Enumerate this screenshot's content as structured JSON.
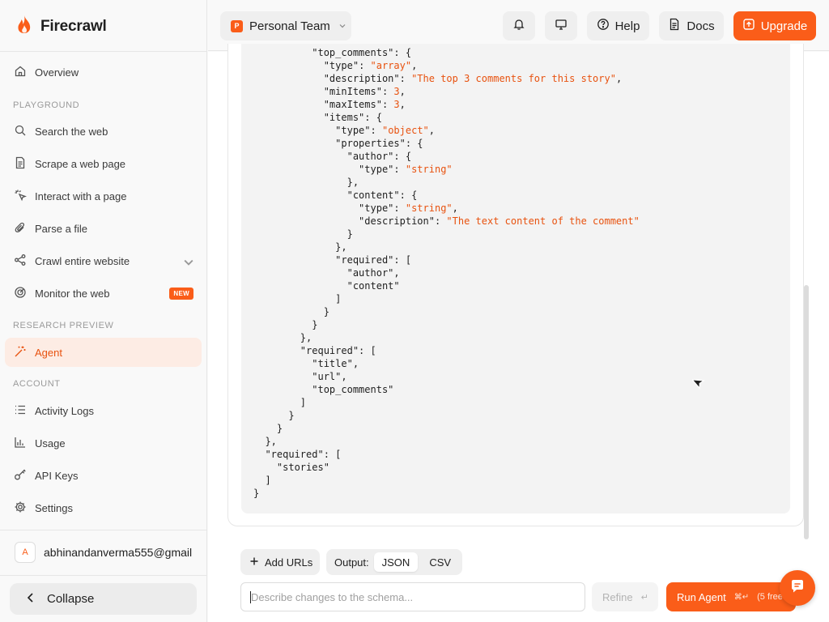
{
  "brand": {
    "name": "Firecrawl",
    "accent": "#fa5d19"
  },
  "sidebar": {
    "items_top": [
      {
        "label": "Overview",
        "icon": "home-icon"
      }
    ],
    "section_playground": "PLAYGROUND",
    "playground": [
      {
        "label": "Search the web",
        "icon": "search-icon"
      },
      {
        "label": "Scrape a web page",
        "icon": "document-icon"
      },
      {
        "label": "Interact with a page",
        "icon": "sparkle-click-icon"
      },
      {
        "label": "Parse a file",
        "icon": "paperclip-icon"
      },
      {
        "label": "Crawl entire website",
        "icon": "crawl-icon"
      },
      {
        "label": "Monitor the web",
        "icon": "monitor-radar-icon",
        "badge": "NEW"
      }
    ],
    "section_research": "RESEARCH PREVIEW",
    "research": [
      {
        "label": "Agent",
        "icon": "wand-icon",
        "active": true
      }
    ],
    "section_account": "ACCOUNT",
    "account": [
      {
        "label": "Activity Logs",
        "icon": "list-icon"
      },
      {
        "label": "Usage",
        "icon": "bar-chart-icon"
      },
      {
        "label": "API Keys",
        "icon": "key-icon"
      },
      {
        "label": "Settings",
        "icon": "gear-icon"
      }
    ],
    "user": {
      "avatar_letter": "A",
      "email": "abhinandanverma555@gmail"
    },
    "collapse_label": "Collapse"
  },
  "topbar": {
    "team_logo_letter": "P",
    "team_name": "Personal Team",
    "help_label": "Help",
    "docs_label": "Docs",
    "upgrade_label": "Upgrade"
  },
  "schema_code": {
    "lines": [
      [
        [
          "          ",
          ""
        ],
        [
          "\"top_comments\"",
          "k"
        ],
        [
          ": {",
          ""
        ]
      ],
      [
        [
          "            ",
          ""
        ],
        [
          "\"type\"",
          "k"
        ],
        [
          ": ",
          ""
        ],
        [
          "\"array\"",
          "s"
        ],
        [
          ",",
          ""
        ]
      ],
      [
        [
          "            ",
          ""
        ],
        [
          "\"description\"",
          "k"
        ],
        [
          ": ",
          ""
        ],
        [
          "\"The top 3 comments for this story\"",
          "s"
        ],
        [
          ",",
          ""
        ]
      ],
      [
        [
          "            ",
          ""
        ],
        [
          "\"minItems\"",
          "k"
        ],
        [
          ": ",
          ""
        ],
        [
          "3",
          "s"
        ],
        [
          ",",
          ""
        ]
      ],
      [
        [
          "            ",
          ""
        ],
        [
          "\"maxItems\"",
          "k"
        ],
        [
          ": ",
          ""
        ],
        [
          "3",
          "s"
        ],
        [
          ",",
          ""
        ]
      ],
      [
        [
          "            ",
          ""
        ],
        [
          "\"items\"",
          "k"
        ],
        [
          ": {",
          ""
        ]
      ],
      [
        [
          "              ",
          ""
        ],
        [
          "\"type\"",
          "k"
        ],
        [
          ": ",
          ""
        ],
        [
          "\"object\"",
          "s"
        ],
        [
          ",",
          ""
        ]
      ],
      [
        [
          "              ",
          ""
        ],
        [
          "\"properties\"",
          "k"
        ],
        [
          ": {",
          ""
        ]
      ],
      [
        [
          "                ",
          ""
        ],
        [
          "\"author\"",
          "k"
        ],
        [
          ": {",
          ""
        ]
      ],
      [
        [
          "                  ",
          ""
        ],
        [
          "\"type\"",
          "k"
        ],
        [
          ": ",
          ""
        ],
        [
          "\"string\"",
          "s"
        ]
      ],
      [
        [
          "                ",
          ""
        ],
        [
          "},",
          ""
        ]
      ],
      [
        [
          "                ",
          ""
        ],
        [
          "\"content\"",
          "k"
        ],
        [
          ": {",
          ""
        ]
      ],
      [
        [
          "                  ",
          ""
        ],
        [
          "\"type\"",
          "k"
        ],
        [
          ": ",
          ""
        ],
        [
          "\"string\"",
          "s"
        ],
        [
          ",",
          ""
        ]
      ],
      [
        [
          "                  ",
          ""
        ],
        [
          "\"description\"",
          "k"
        ],
        [
          ": ",
          ""
        ],
        [
          "\"The text content of the comment\"",
          "s"
        ]
      ],
      [
        [
          "                ",
          ""
        ],
        [
          "}",
          ""
        ]
      ],
      [
        [
          "              ",
          ""
        ],
        [
          "},",
          ""
        ]
      ],
      [
        [
          "              ",
          ""
        ],
        [
          "\"required\"",
          "k"
        ],
        [
          ": [",
          ""
        ]
      ],
      [
        [
          "                ",
          ""
        ],
        [
          "\"author\"",
          ""
        ],
        [
          ",",
          ""
        ]
      ],
      [
        [
          "                ",
          ""
        ],
        [
          "\"content\"",
          ""
        ]
      ],
      [
        [
          "              ",
          ""
        ],
        [
          "]",
          ""
        ]
      ],
      [
        [
          "            ",
          ""
        ],
        [
          "}",
          ""
        ]
      ],
      [
        [
          "          ",
          ""
        ],
        [
          "}",
          ""
        ]
      ],
      [
        [
          "        ",
          ""
        ],
        [
          "},",
          ""
        ]
      ],
      [
        [
          "        ",
          ""
        ],
        [
          "\"required\"",
          "k"
        ],
        [
          ": [",
          ""
        ]
      ],
      [
        [
          "          ",
          ""
        ],
        [
          "\"title\"",
          ""
        ],
        [
          ",",
          ""
        ]
      ],
      [
        [
          "          ",
          ""
        ],
        [
          "\"url\"",
          ""
        ],
        [
          ",",
          ""
        ]
      ],
      [
        [
          "          ",
          ""
        ],
        [
          "\"top_comments\"",
          ""
        ]
      ],
      [
        [
          "        ",
          ""
        ],
        [
          "]",
          ""
        ]
      ],
      [
        [
          "      ",
          ""
        ],
        [
          "}",
          ""
        ]
      ],
      [
        [
          "    ",
          ""
        ],
        [
          "}",
          ""
        ]
      ],
      [
        [
          "  ",
          ""
        ],
        [
          "},",
          ""
        ]
      ],
      [
        [
          "  ",
          ""
        ],
        [
          "\"required\"",
          "k"
        ],
        [
          ": [",
          ""
        ]
      ],
      [
        [
          "    ",
          ""
        ],
        [
          "\"stories\"",
          ""
        ]
      ],
      [
        [
          "  ",
          ""
        ],
        [
          "]",
          ""
        ]
      ],
      [
        [
          "",
          ""
        ],
        [
          "}",
          ""
        ]
      ]
    ]
  },
  "actions": {
    "add_urls_label": "Add URLs",
    "output_label": "Output:",
    "output_options": [
      "JSON",
      "CSV"
    ],
    "output_selected": "JSON",
    "schema_input_placeholder": "Describe changes to the schema...",
    "schema_input_value": "",
    "refine_label": "Refine",
    "refine_shortcut": "↵",
    "run_label": "Run Agent",
    "run_shortcut": "⌘↵",
    "run_free_note": "(5 free"
  }
}
